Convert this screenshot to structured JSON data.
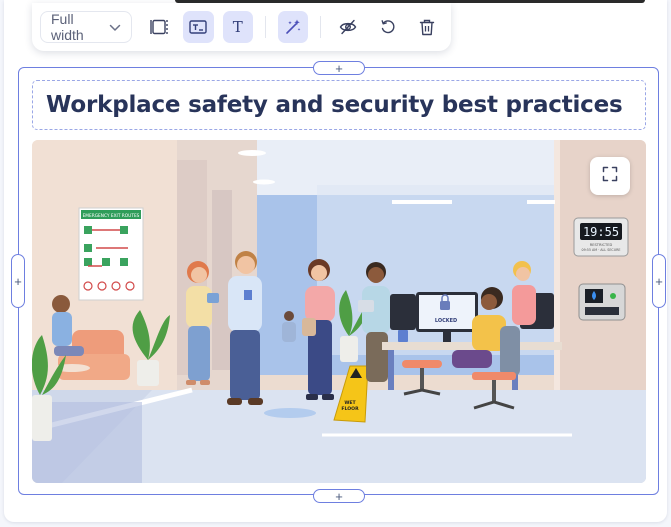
{
  "toolbar": {
    "width_select": {
      "value": "Full width",
      "icon": "chevron-down-icon"
    },
    "buttons": [
      {
        "name": "layout-frame-button",
        "icon": "frame-icon",
        "active": false
      },
      {
        "name": "caption-toggle-button",
        "icon": "caption-icon",
        "active": true
      },
      {
        "name": "text-toggle-button",
        "icon": "text-icon",
        "active": true,
        "glyph": "T"
      },
      {
        "name": "ai-magic-button",
        "icon": "magic-wand-icon",
        "active": true
      },
      {
        "name": "hide-button",
        "icon": "eye-off-icon",
        "active": false
      },
      {
        "name": "regenerate-button",
        "icon": "refresh-icon",
        "active": false
      },
      {
        "name": "delete-button",
        "icon": "trash-icon",
        "active": false
      }
    ]
  },
  "block": {
    "add_above": "+",
    "add_below": "+",
    "resize_left": "+",
    "resize_right": "+",
    "title": "Workplace safety and security best practices"
  },
  "image": {
    "poster_title": "EMERGENCY EXIT ROUTES",
    "monitor_label": "LOCKED",
    "clock_time": "19:55",
    "clock_caption_1": "RESTRICTED",
    "clock_caption_2": "09:55 AM · ALL SECURE",
    "sign_label_1": "WET",
    "sign_label_2": "FLOOR"
  },
  "colors": {
    "accent": "#6e7fe0",
    "active_button_bg": "#dfe3fb",
    "title_text": "#28345a"
  }
}
